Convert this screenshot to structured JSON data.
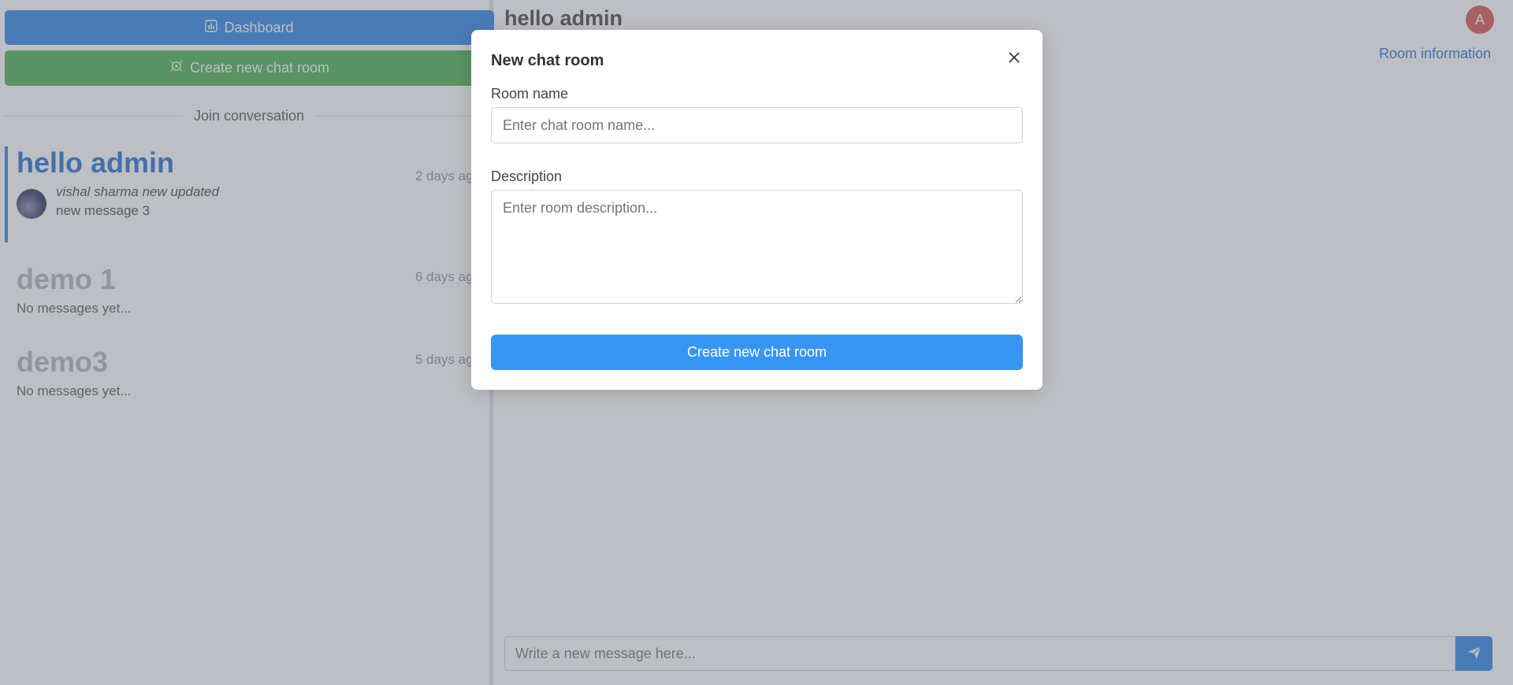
{
  "sidebar": {
    "dashboard_label": "Dashboard",
    "create_room_label": "Create new chat room",
    "join_divider": "Join conversation",
    "rooms": [
      {
        "name": "hello admin",
        "time": "2 days ago",
        "latest_sender": "vishal sharma new updated",
        "latest_text": "new message 3"
      },
      {
        "name": "demo 1",
        "time": "6 days ago",
        "preview": "No messages yet..."
      },
      {
        "name": "demo3",
        "time": "5 days ago",
        "preview": "No messages yet..."
      }
    ]
  },
  "main": {
    "title": "hello admin",
    "user_initial": "A",
    "room_info_label": "Room information",
    "message_placeholder": "Write a new message here..."
  },
  "modal": {
    "title": "New chat room",
    "room_name_label": "Room name",
    "room_name_placeholder": "Enter chat room name...",
    "description_label": "Description",
    "description_placeholder": "Enter room description...",
    "submit_label": "Create new chat room"
  },
  "colors": {
    "primary": "#2d86e6",
    "success": "#4caf50",
    "avatar": "#d9534f",
    "link": "#1f6fd1"
  }
}
